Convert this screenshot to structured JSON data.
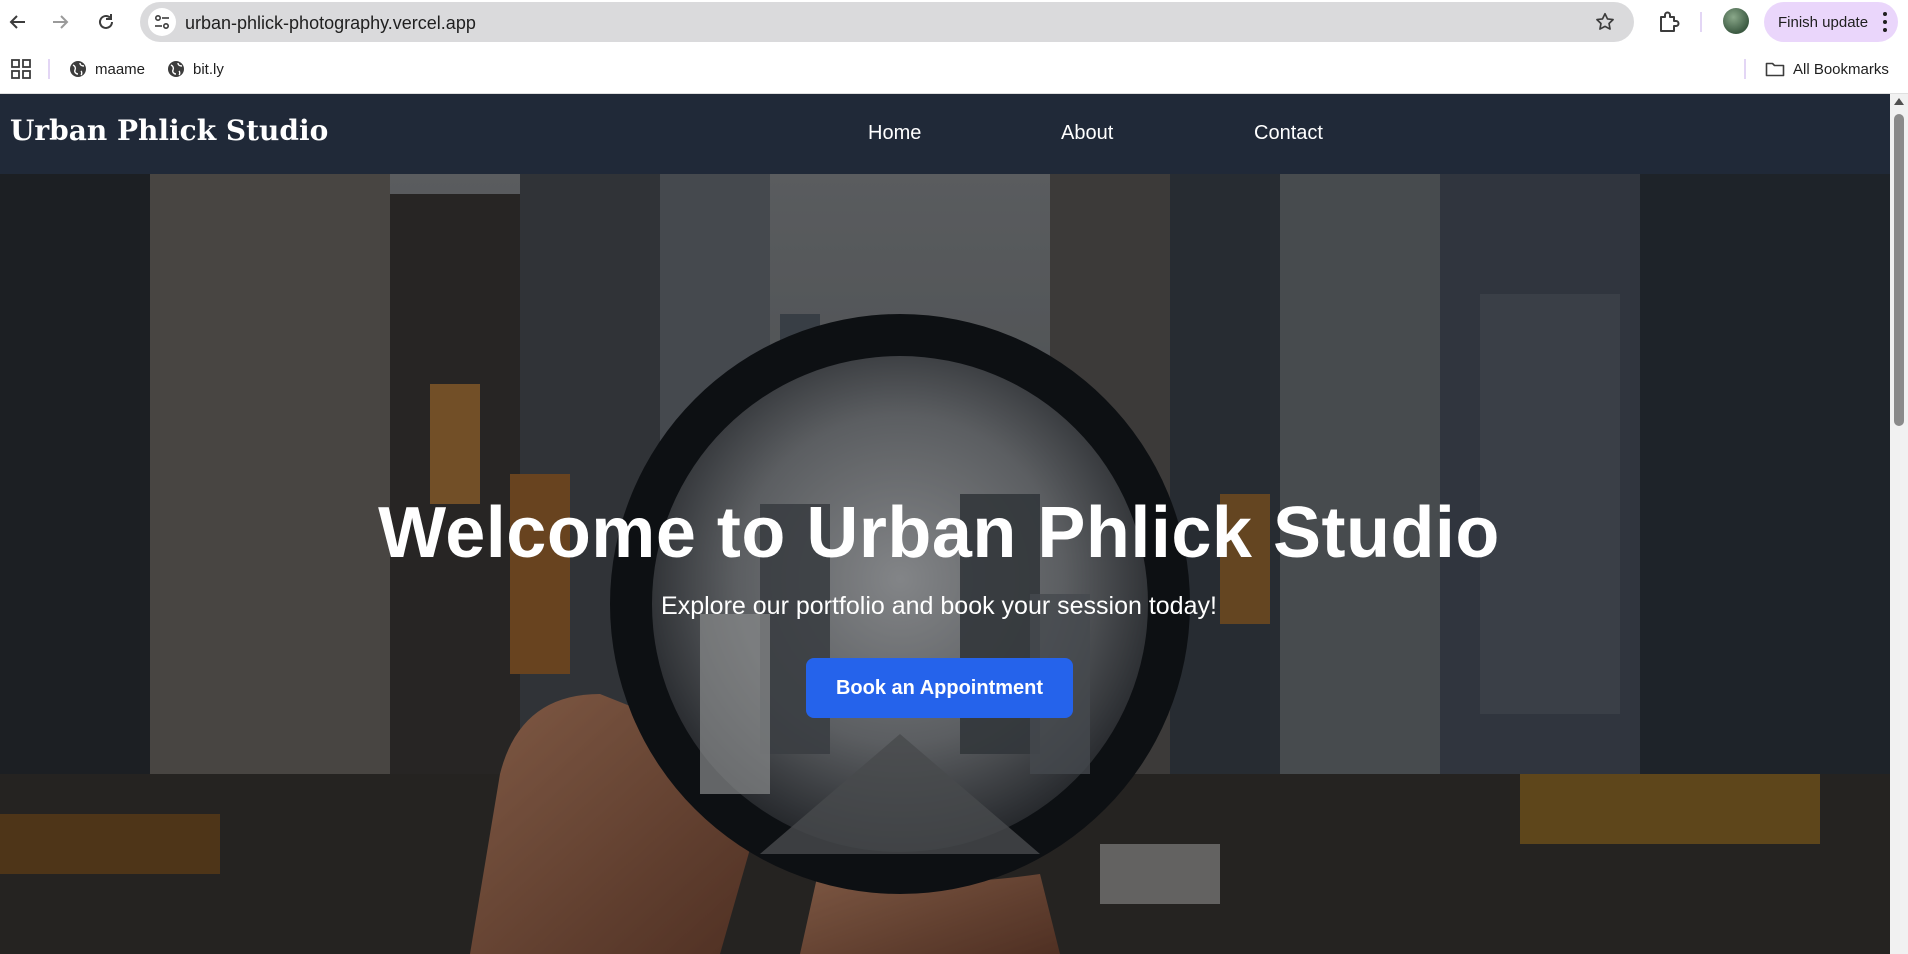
{
  "browser": {
    "url": "urban-phlick-photography.vercel.app",
    "finish_update_label": "Finish update",
    "bookmarks": [
      {
        "label": "maame"
      },
      {
        "label": "bit.ly"
      }
    ],
    "all_bookmarks_label": "All Bookmarks"
  },
  "site": {
    "brand": "Urban Phlick Studio",
    "nav": {
      "home": "Home",
      "about": "About",
      "contact": "Contact"
    },
    "hero": {
      "title": "Welcome to Urban Phlick Studio",
      "subtitle": "Explore our portfolio and book your session today!",
      "cta_label": "Book an Appointment"
    }
  },
  "colors": {
    "header_bg": "#202938",
    "cta_bg": "#2563eb",
    "finish_update_bg": "#ead6fb"
  }
}
